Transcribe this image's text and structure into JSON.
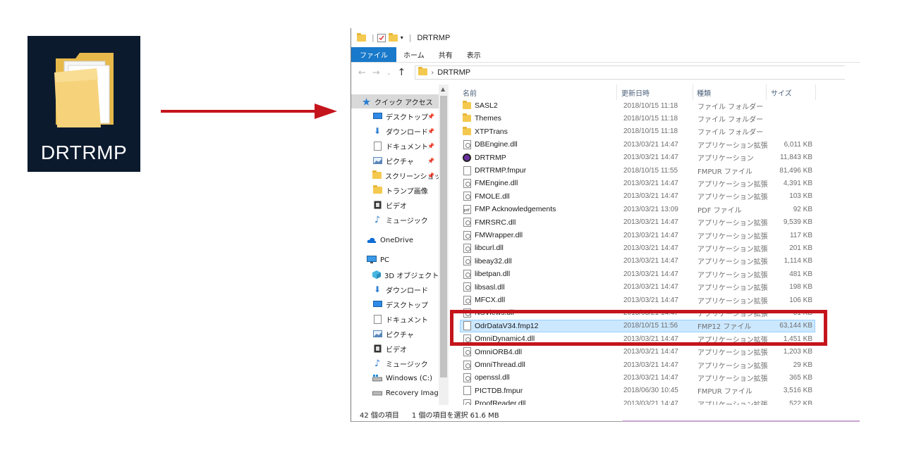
{
  "desktop_icon": {
    "label": "DRTRMP",
    "icon": "folder-icon"
  },
  "arrow": {
    "color": "#c4151c"
  },
  "window": {
    "title": "DRTRMP",
    "ribbon_tabs": [
      "ファイル",
      "ホーム",
      "共有",
      "表示"
    ],
    "address": {
      "crumbs": [
        "DRTRMP"
      ]
    },
    "accent": "#1979ca"
  },
  "nav": {
    "quick_access": "クイック アクセス",
    "items": [
      {
        "label": "デスクトップ",
        "icon": "desktop-icon",
        "pinned": true
      },
      {
        "label": "ダウンロード",
        "icon": "download-icon",
        "pinned": true
      },
      {
        "label": "ドキュメント",
        "icon": "document-icon",
        "pinned": true
      },
      {
        "label": "ピクチャ",
        "icon": "picture-icon",
        "pinned": true
      },
      {
        "label": "スクリーンショッ",
        "icon": "folder-icon",
        "pinned": true
      },
      {
        "label": "トランプ画像",
        "icon": "folder-icon",
        "pinned": false
      },
      {
        "label": "ビデオ",
        "icon": "video-icon",
        "pinned": false
      },
      {
        "label": "ミュージック",
        "icon": "music-icon",
        "pinned": false
      }
    ],
    "onedrive": "OneDrive",
    "pc": "PC",
    "pc_items": [
      {
        "label": "3D オブジェクト",
        "icon": "cube-icon"
      },
      {
        "label": "ダウンロード",
        "icon": "download-icon"
      },
      {
        "label": "デスクトップ",
        "icon": "desktop-icon"
      },
      {
        "label": "ドキュメント",
        "icon": "document-icon"
      },
      {
        "label": "ピクチャ",
        "icon": "picture-icon"
      },
      {
        "label": "ビデオ",
        "icon": "video-icon"
      },
      {
        "label": "ミュージック",
        "icon": "music-icon"
      },
      {
        "label": "Windows (C:)",
        "icon": "drive-icon"
      },
      {
        "label": "Recovery Image",
        "icon": "drive-icon"
      }
    ]
  },
  "columns": {
    "name": "名前",
    "date": "更新日時",
    "type": "種類",
    "size": "サイズ"
  },
  "files": [
    {
      "name": "SASL2",
      "date": "2018/10/15 11:18",
      "type": "ファイル フォルダー",
      "size": "",
      "icon": "folder"
    },
    {
      "name": "Themes",
      "date": "2018/10/15 11:18",
      "type": "ファイル フォルダー",
      "size": "",
      "icon": "folder"
    },
    {
      "name": "XTPTrans",
      "date": "2018/10/15 11:18",
      "type": "ファイル フォルダー",
      "size": "",
      "icon": "folder"
    },
    {
      "name": "DBEngine.dll",
      "date": "2013/03/21 14:47",
      "type": "アプリケーション拡張",
      "size": "6,011 KB",
      "icon": "dll"
    },
    {
      "name": "DRTRMP",
      "date": "2013/03/21 14:47",
      "type": "アプリケーション",
      "size": "11,843 KB",
      "icon": "app"
    },
    {
      "name": "DRTRMP.fmpur",
      "date": "2018/10/15 11:55",
      "type": "FMPUR ファイル",
      "size": "81,496 KB",
      "icon": "file"
    },
    {
      "name": "FMEngine.dll",
      "date": "2013/03/21 14:47",
      "type": "アプリケーション拡張",
      "size": "4,391 KB",
      "icon": "dll"
    },
    {
      "name": "FMOLE.dll",
      "date": "2013/03/21 14:47",
      "type": "アプリケーション拡張",
      "size": "103 KB",
      "icon": "dll"
    },
    {
      "name": "FMP Acknowledgements",
      "date": "2013/03/21 13:09",
      "type": "PDF ファイル",
      "size": "92 KB",
      "icon": "pdf"
    },
    {
      "name": "FMRSRC.dll",
      "date": "2013/03/21 14:47",
      "type": "アプリケーション拡張",
      "size": "9,539 KB",
      "icon": "dll"
    },
    {
      "name": "FMWrapper.dll",
      "date": "2013/03/21 14:47",
      "type": "アプリケーション拡張",
      "size": "117 KB",
      "icon": "dll"
    },
    {
      "name": "libcurl.dll",
      "date": "2013/03/21 14:47",
      "type": "アプリケーション拡張",
      "size": "201 KB",
      "icon": "dll"
    },
    {
      "name": "libeay32.dll",
      "date": "2013/03/21 14:47",
      "type": "アプリケーション拡張",
      "size": "1,114 KB",
      "icon": "dll"
    },
    {
      "name": "libetpan.dll",
      "date": "2013/03/21 14:47",
      "type": "アプリケーション拡張",
      "size": "481 KB",
      "icon": "dll"
    },
    {
      "name": "libsasl.dll",
      "date": "2013/03/21 14:47",
      "type": "アプリケーション拡張",
      "size": "198 KB",
      "icon": "dll"
    },
    {
      "name": "MFCX.dll",
      "date": "2013/03/21 14:47",
      "type": "アプリケーション拡張",
      "size": "106 KB",
      "icon": "dll"
    },
    {
      "name": "NSViews.dll",
      "date": "2013/03/21 14:47",
      "type": "アプリケーション拡張",
      "size": "51 KB",
      "icon": "dll"
    },
    {
      "name": "OdrDataV34.fmp12",
      "date": "2018/10/15 11:56",
      "type": "FMP12 ファイル",
      "size": "63,144 KB",
      "icon": "file",
      "selected": true
    },
    {
      "name": "OmniDynamic4.dll",
      "date": "2013/03/21 14:47",
      "type": "アプリケーション拡張",
      "size": "1,451 KB",
      "icon": "dll"
    },
    {
      "name": "OmniORB4.dll",
      "date": "2013/03/21 14:47",
      "type": "アプリケーション拡張",
      "size": "1,203 KB",
      "icon": "dll"
    },
    {
      "name": "OmniThread.dll",
      "date": "2013/03/21 14:47",
      "type": "アプリケーション拡張",
      "size": "29 KB",
      "icon": "dll"
    },
    {
      "name": "openssl.dll",
      "date": "2013/03/21 14:47",
      "type": "アプリケーション拡張",
      "size": "365 KB",
      "icon": "dll"
    },
    {
      "name": "PICTDB.fmpur",
      "date": "2018/06/30 10:45",
      "type": "FMPUR ファイル",
      "size": "3,516 KB",
      "icon": "file"
    },
    {
      "name": "ProofReader.dll",
      "date": "2013/03/21 14:47",
      "type": "アプリケーション拡張",
      "size": "522 KB",
      "icon": "dll"
    }
  ],
  "status": {
    "count": "42 個の項目",
    "selection": "1 個の項目を選択  61.6 MB"
  },
  "highlight_color": "#c4151c"
}
